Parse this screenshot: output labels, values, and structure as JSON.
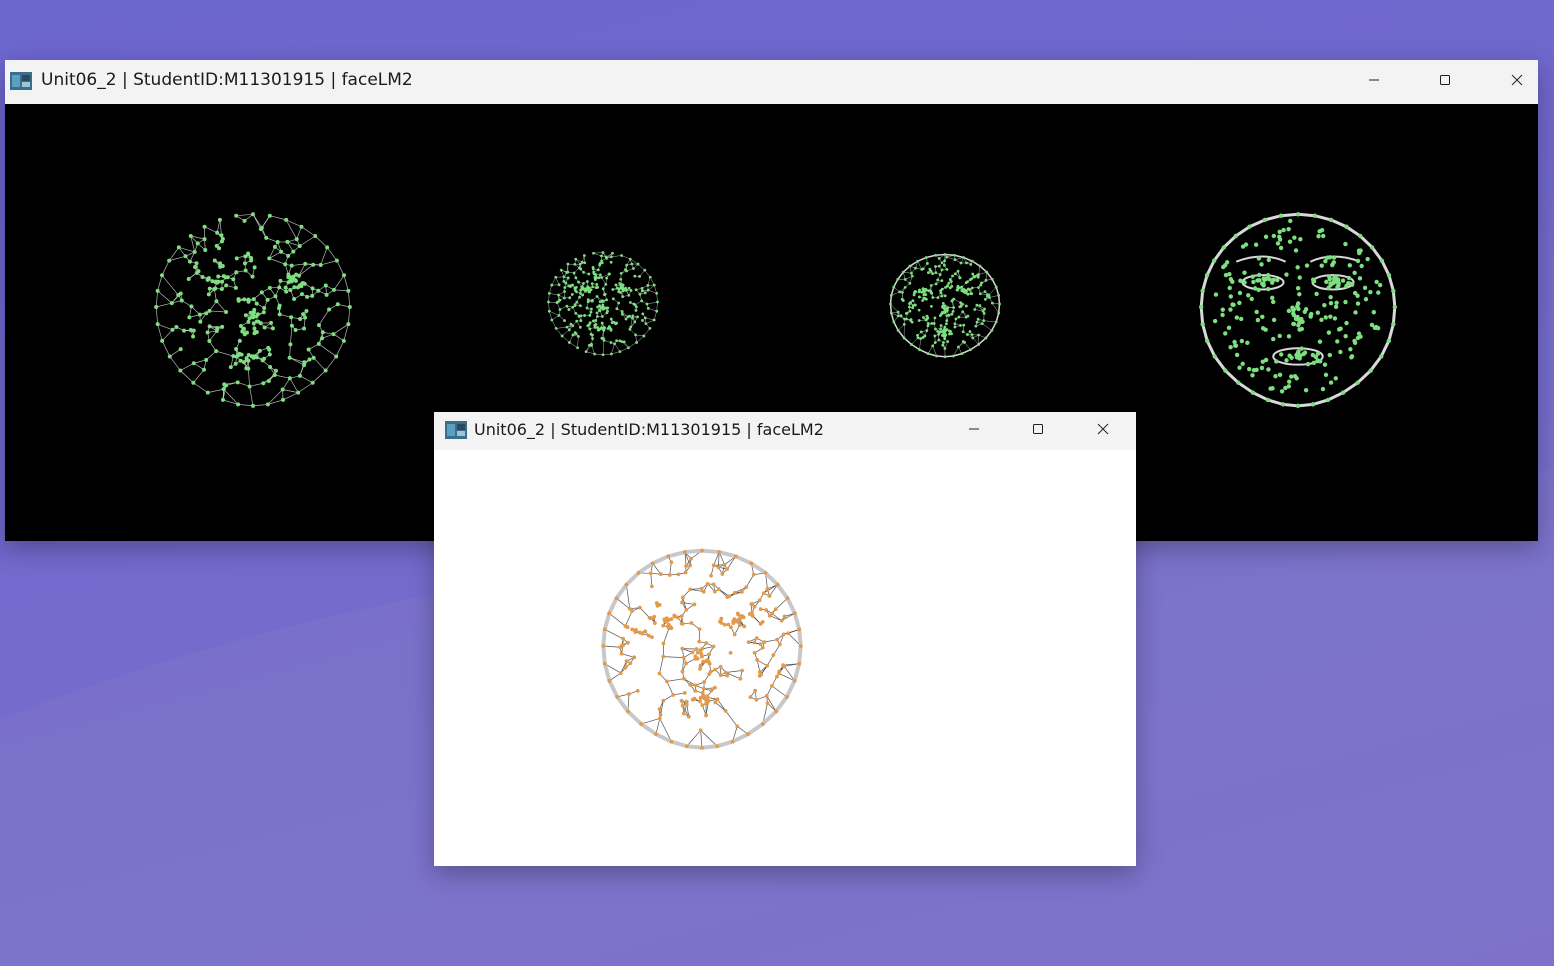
{
  "colors": {
    "desktop": "#7068cc",
    "titlebar": "#f3f3f3",
    "main_canvas": "#000000",
    "front_canvas": "#ffffff",
    "landmark_green": "#7ddf7f",
    "mesh_white": "#d9d9d9",
    "landmark_orange": "#e39a4a",
    "mesh_dark": "#333333"
  },
  "windows": {
    "main": {
      "title": "Unit06_2 | StudentID:M11301915 | faceLM2",
      "app_icon": "python-window-icon",
      "controls": [
        "minimize-icon",
        "maximize-icon",
        "close-icon"
      ],
      "canvas": {
        "faces": [
          {
            "style": "wireframe-mesh-with-landmarks",
            "landmark_color": "green",
            "mesh_color": "white"
          },
          {
            "style": "landmark-points",
            "landmark_color": "green",
            "mesh_color": "white"
          },
          {
            "style": "landmark-points",
            "landmark_color": "green",
            "mesh_color": "white"
          },
          {
            "style": "contours-with-landmark-points",
            "landmark_color": "green",
            "mesh_color": "white"
          }
        ]
      }
    },
    "front": {
      "title": "Unit06_2 | StudentID:M11301915 | faceLM2",
      "app_icon": "python-window-icon",
      "controls": [
        "minimize-icon",
        "maximize-icon",
        "close-icon"
      ],
      "canvas": {
        "faces": [
          {
            "style": "wireframe-mesh-with-landmarks",
            "landmark_color": "orange",
            "mesh_color": "dark-gray"
          }
        ]
      }
    }
  }
}
